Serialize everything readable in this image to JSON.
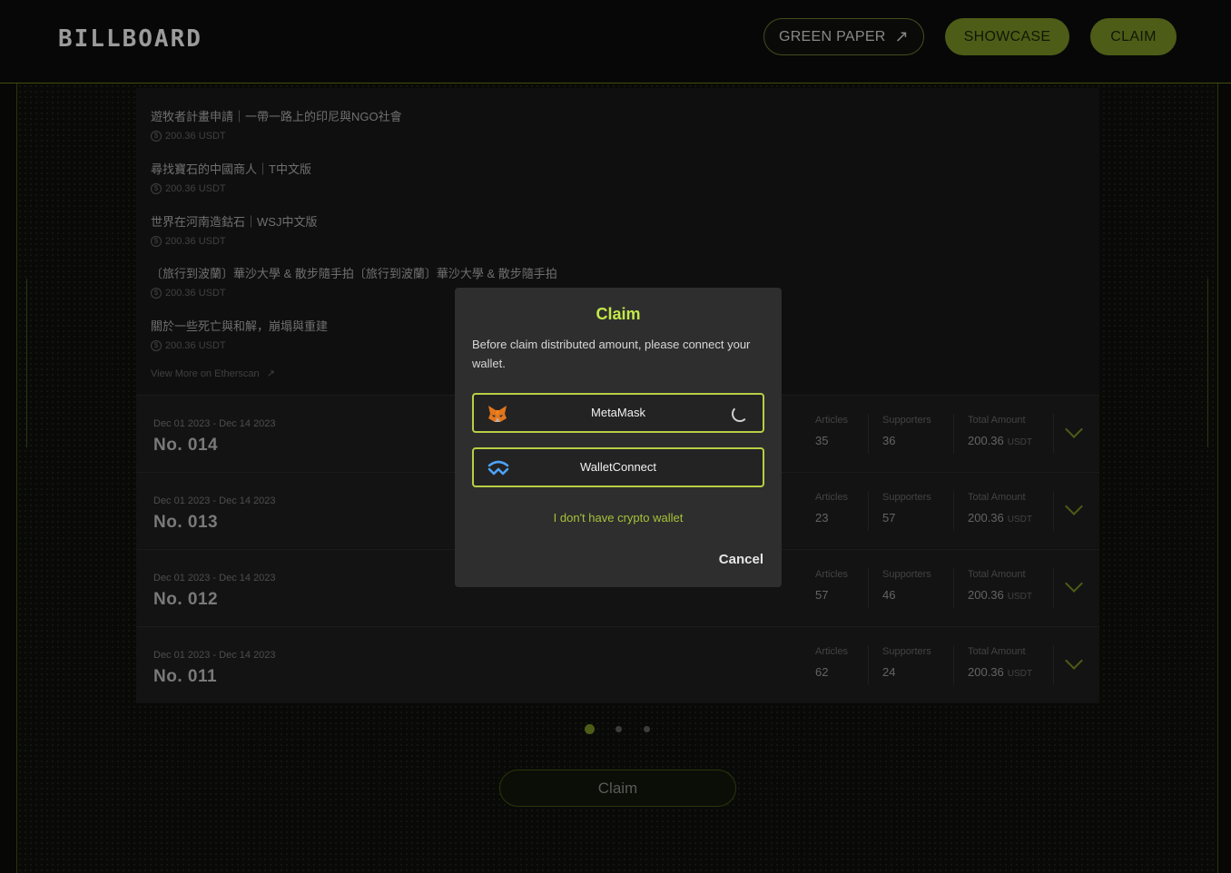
{
  "header": {
    "logo": "BILLBOARD",
    "green_paper_label": "GREEN PAPER",
    "green_paper_icon": "arrow-up-right-icon",
    "showcase_label": "SHOWCASE",
    "claim_label": "CLAIM"
  },
  "articles": [
    {
      "title": "遊牧者計畫申請｜一帶一路上的印尼與NGO社會",
      "price": "200.36 USDT"
    },
    {
      "title": "尋找寶石的中國商人｜T中文版",
      "price": "200.36 USDT"
    },
    {
      "title": "世界在河南造鈷石｜WSJ中文版",
      "price": "200.36 USDT"
    },
    {
      "title": "〔旅行到波蘭〕華沙大學 & 散步隨手拍〔旅行到波蘭〕華沙大學 & 散步隨手拍",
      "price": "200.36 USDT"
    },
    {
      "title": "關於一些死亡與和解，崩塌與重建",
      "price": "200.36 USDT"
    }
  ],
  "view_more": "View More on Etherscan",
  "stat_labels": {
    "articles": "Articles",
    "supporters": "Supporters",
    "total": "Total Amount"
  },
  "issues": [
    {
      "dates": "Dec 01 2023 - Dec 14 2023",
      "number": "No. 014",
      "articles": "35",
      "supporters": "36",
      "total": "200.36",
      "unit": "USDT"
    },
    {
      "dates": "Dec 01 2023 - Dec 14 2023",
      "number": "No. 013",
      "articles": "23",
      "supporters": "57",
      "total": "200.36",
      "unit": "USDT"
    },
    {
      "dates": "Dec 01 2023 - Dec 14 2023",
      "number": "No. 012",
      "articles": "57",
      "supporters": "46",
      "total": "200.36",
      "unit": "USDT"
    },
    {
      "dates": "Dec 01 2023 - Dec 14 2023",
      "number": "No. 011",
      "articles": "62",
      "supporters": "24",
      "total": "200.36",
      "unit": "USDT"
    }
  ],
  "pagination": {
    "pages": 3,
    "active": 1
  },
  "claim_button": "Claim",
  "modal": {
    "title": "Claim",
    "description": "Before claim distributed amount, please connect your wallet.",
    "metamask_label": "MetaMask",
    "walletconnect_label": "WalletConnect",
    "no_wallet": "I don't have crypto wallet",
    "cancel": "Cancel"
  },
  "colors": {
    "accent": "#c2e84a",
    "button_green": "#6b8221",
    "modal_bg": "#2e2e2e"
  }
}
